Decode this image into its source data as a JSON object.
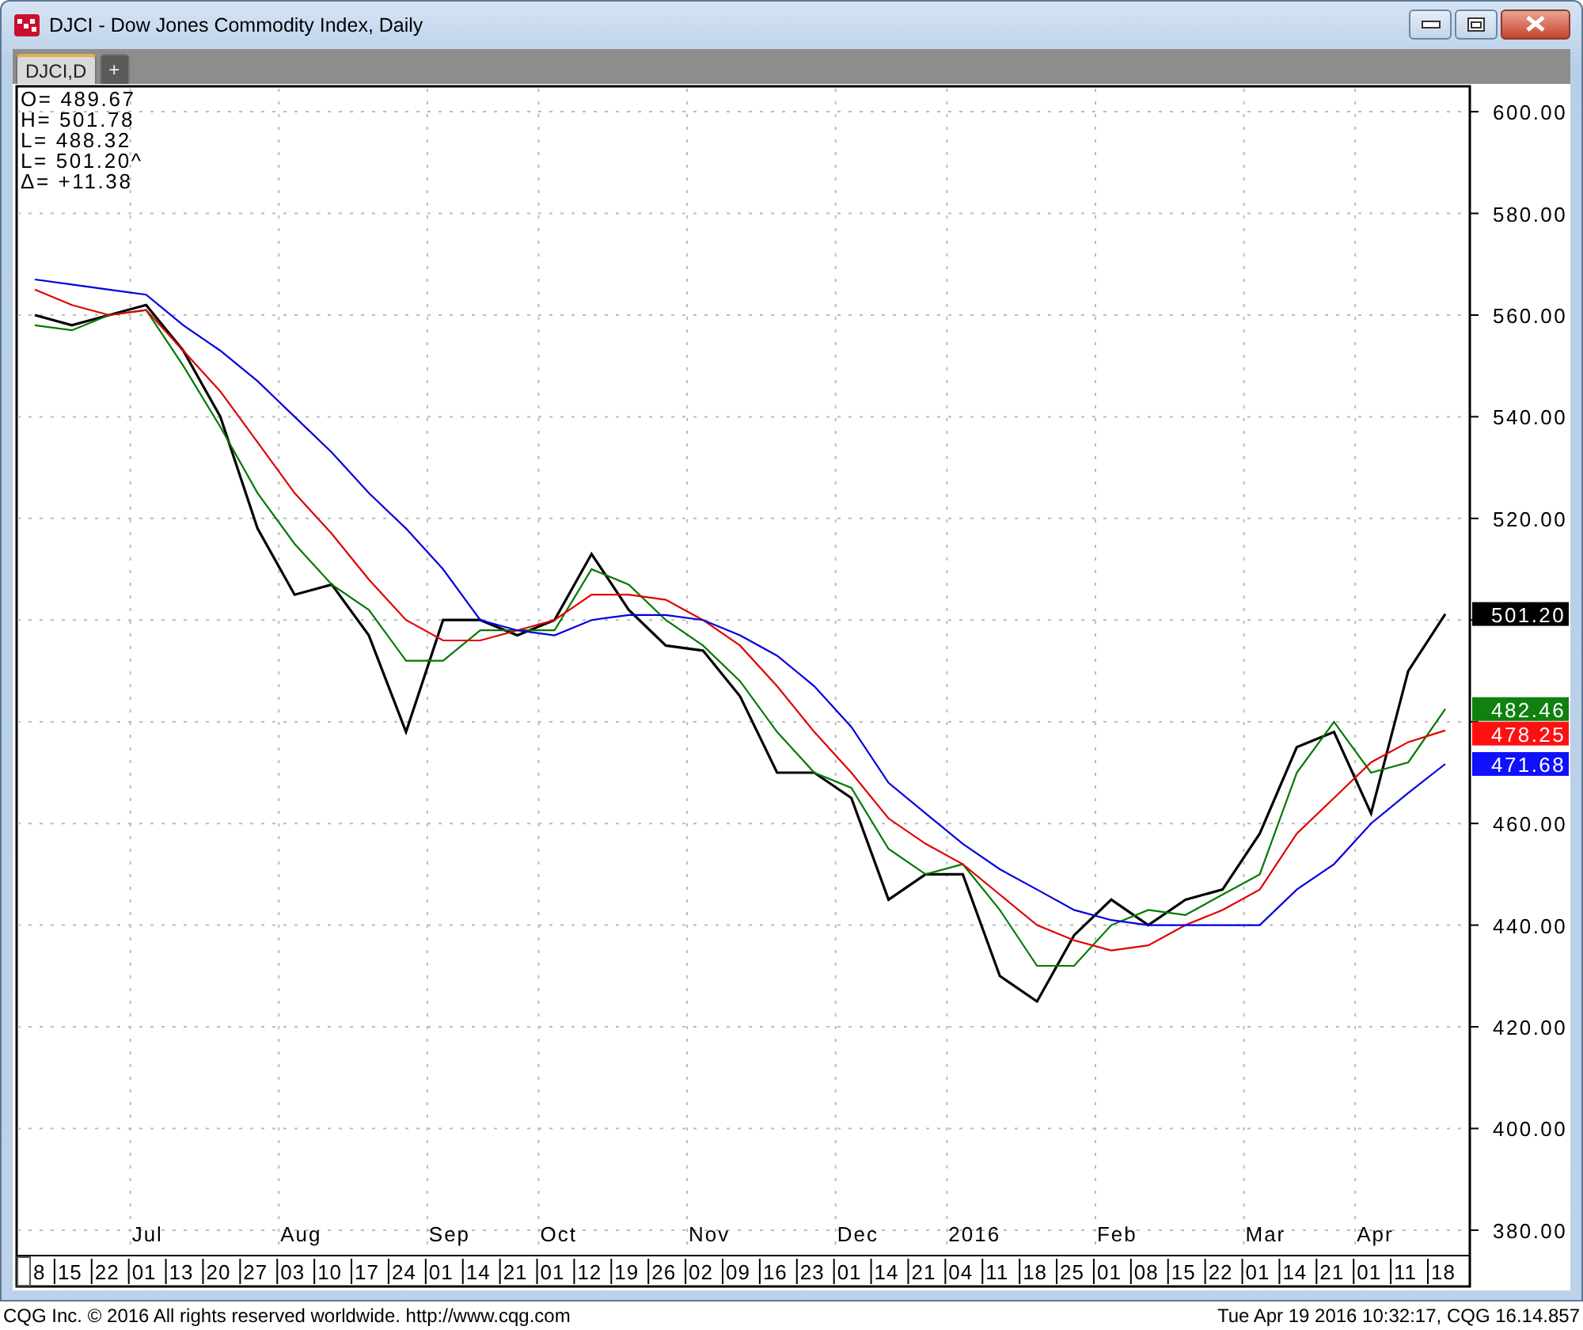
{
  "window": {
    "title": "DJCI - Dow Jones Commodity Index, Daily"
  },
  "tabs": [
    {
      "label": "DJCI,D",
      "selected": true
    },
    {
      "label": "+",
      "selected": false
    }
  ],
  "readout": [
    "O= 489.67",
    "H= 501.78",
    "L= 488.32",
    "L= 501.20^",
    "Δ= +11.38"
  ],
  "chart_data": {
    "type": "line",
    "categories": [
      "8",
      "15",
      "22",
      "01",
      "13",
      "20",
      "27",
      "03",
      "10",
      "17",
      "24",
      "01",
      "14",
      "21",
      "01",
      "12",
      "19",
      "26",
      "02",
      "09",
      "16",
      "23",
      "01",
      "14",
      "21",
      "04",
      "11",
      "18",
      "25",
      "01",
      "08",
      "15",
      "22",
      "01",
      "14",
      "21",
      "01",
      "11",
      "18"
    ],
    "ylim": [
      375,
      605
    ],
    "grid": true,
    "yticks": [
      {
        "value": 380,
        "label": "380.00"
      },
      {
        "value": 400,
        "label": "400.00"
      },
      {
        "value": 420,
        "label": "420.00"
      },
      {
        "value": 440,
        "label": "440.00"
      },
      {
        "value": 460,
        "label": "460.00"
      },
      {
        "value": 520,
        "label": "520.00"
      },
      {
        "value": 540,
        "label": "540.00"
      },
      {
        "value": 560,
        "label": "560.00"
      },
      {
        "value": 580,
        "label": "580.00"
      },
      {
        "value": 600,
        "label": "600.00"
      }
    ],
    "series": [
      {
        "color": "#000000",
        "values": [
          560,
          558,
          560,
          562,
          553,
          540,
          518,
          505,
          507,
          497,
          478,
          500,
          500,
          497,
          500,
          513,
          502,
          495,
          494,
          485,
          470,
          470,
          465,
          445,
          450,
          450,
          430,
          425,
          438,
          445,
          440,
          445,
          447,
          458,
          475,
          478,
          462,
          490,
          501.2
        ]
      },
      {
        "color": "#007a00",
        "values": [
          558,
          557,
          560,
          561,
          550,
          538,
          525,
          515,
          507,
          502,
          492,
          492,
          498,
          498,
          498,
          510,
          507,
          500,
          495,
          488,
          478,
          470,
          467,
          455,
          450,
          452,
          443,
          432,
          432,
          440,
          443,
          442,
          446,
          450,
          470,
          480,
          470,
          472,
          482.5
        ]
      },
      {
        "color": "#e00000",
        "values": [
          565,
          562,
          560,
          561,
          553,
          545,
          535,
          525,
          517,
          508,
          500,
          496,
          496,
          498,
          500,
          505,
          505,
          504,
          500,
          495,
          487,
          478,
          470,
          461,
          456,
          452,
          446,
          440,
          437,
          435,
          436,
          440,
          443,
          447,
          458,
          465,
          472,
          476,
          478.3
        ]
      },
      {
        "color": "#0000e0",
        "values": [
          567,
          566,
          565,
          564,
          558,
          553,
          547,
          540,
          533,
          525,
          518,
          510,
          500,
          498,
          497,
          500,
          501,
          501,
          500,
          497,
          493,
          487,
          479,
          468,
          462,
          456,
          451,
          447,
          443,
          441,
          440,
          440,
          440,
          440,
          447,
          452,
          460,
          466,
          471.7
        ]
      }
    ]
  },
  "month_labels": [
    "Jul",
    "Aug",
    "Sep",
    "Oct",
    "Nov",
    "Dec",
    "2016",
    "Feb",
    "Mar",
    "Apr"
  ],
  "value_tags": [
    {
      "text": "501.20",
      "color": "#000000"
    },
    {
      "text": "482.46",
      "color": "#108010"
    },
    {
      "text": "478.25",
      "color": "#ff1010"
    },
    {
      "text": "471.68",
      "color": "#1010ff"
    }
  ],
  "status_bar": {
    "left": "CQG Inc. © 2016 All rights reserved worldwide. http://www.cqg.com",
    "right": "Tue Apr 19 2016 10:32:17, CQG 16.14.857"
  }
}
